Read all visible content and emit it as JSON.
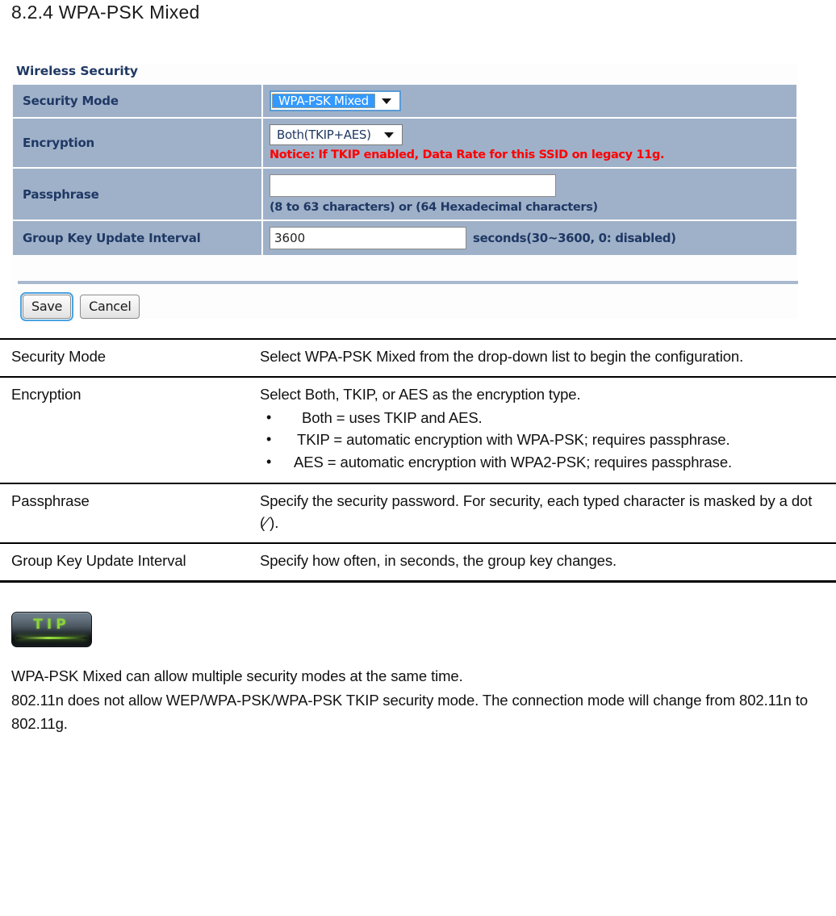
{
  "heading": "8.2.4 WPA-PSK Mixed",
  "panel": {
    "title": "Wireless Security",
    "rows": {
      "security_mode": {
        "label": "Security Mode",
        "selected_value": "WPA-PSK Mixed"
      },
      "encryption": {
        "label": "Encryption",
        "selected_value": "Both(TKIP+AES)",
        "notice": "Notice: If TKIP enabled, Data Rate for this SSID on legacy 11g."
      },
      "passphrase": {
        "label": "Passphrase",
        "value": "",
        "hint": "(8 to 63 characters) or (64 Hexadecimal characters)"
      },
      "group_key": {
        "label": "Group Key Update Interval",
        "value": "3600",
        "unit": "seconds(30~3600, 0: disabled)"
      }
    },
    "buttons": {
      "save": "Save",
      "cancel": "Cancel"
    }
  },
  "description_table": {
    "rows": [
      {
        "term": "Security Mode",
        "text": "Select WPA-PSK Mixed from the drop-down  list to begin the configuration."
      },
      {
        "term": "Encryption",
        "text": "Select Both, TKIP, or AES as the encryption type.",
        "bullets": [
          "Both = uses TKIP and AES.",
          "TKIP = automatic encryption with WPA-PSK; requires passphrase.",
          "AES = automatic encryption with WPA2-PSK; requires passphrase."
        ]
      },
      {
        "term": "Passphrase",
        "text_before_dot": "Specify the security password. For security, each typed character is masked by a dot (",
        "dot_glyph": "⁄",
        "text_after_dot": ")."
      },
      {
        "term": "Group Key Update Interval",
        "text": "Specify how often, in seconds, the group key changes."
      }
    ]
  },
  "tip": {
    "badge_label": "TIP",
    "lines": [
      "WPA-PSK Mixed can allow multiple  security modes at the same time.",
      "802.11n does not allow WEP/WPA-PSK/WPA-PSK TKIP security mode. The connection mode will change from 802.11n to 802.11g."
    ]
  },
  "colors": {
    "row_bg": "#9fb1c9",
    "label_text": "#1f3864",
    "notice_red": "#ff0000",
    "select_highlight": "#3399ff",
    "tip_green": "#8dd43b"
  }
}
